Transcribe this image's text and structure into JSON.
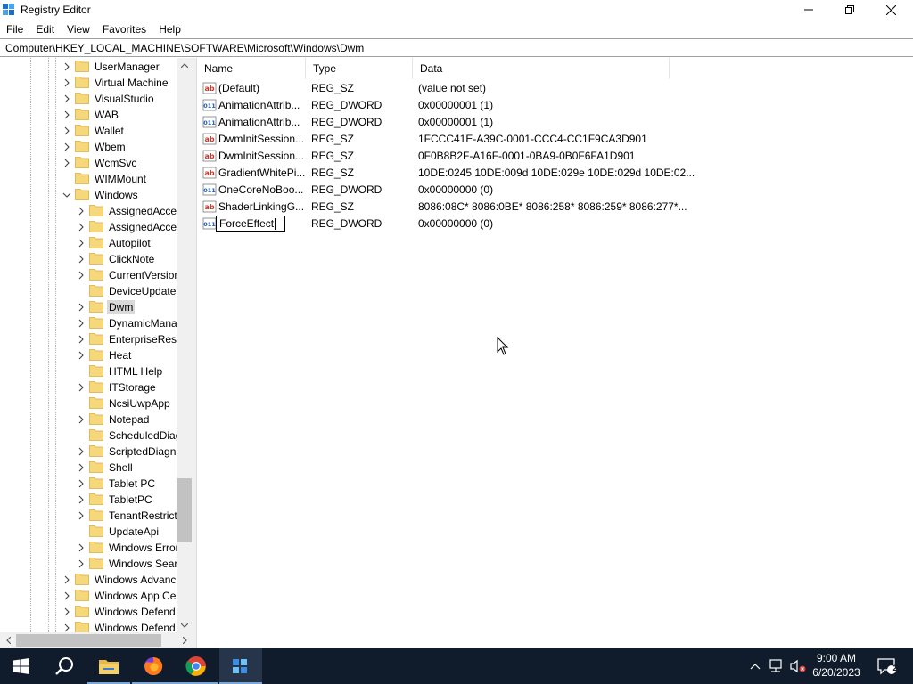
{
  "window": {
    "title": "Registry Editor"
  },
  "menu": [
    "File",
    "Edit",
    "View",
    "Favorites",
    "Help"
  ],
  "address": "Computer\\HKEY_LOCAL_MACHINE\\SOFTWARE\\Microsoft\\Windows\\Dwm",
  "tree": {
    "items": [
      {
        "label": "UserManager",
        "level": 1,
        "expanded": false,
        "expandable": true
      },
      {
        "label": "Virtual Machine",
        "level": 1,
        "expanded": false,
        "expandable": true
      },
      {
        "label": "VisualStudio",
        "level": 1,
        "expanded": false,
        "expandable": true
      },
      {
        "label": "WAB",
        "level": 1,
        "expanded": false,
        "expandable": true
      },
      {
        "label": "Wallet",
        "level": 1,
        "expanded": false,
        "expandable": true
      },
      {
        "label": "Wbem",
        "level": 1,
        "expanded": false,
        "expandable": true
      },
      {
        "label": "WcmSvc",
        "level": 1,
        "expanded": false,
        "expandable": true
      },
      {
        "label": "WIMMount",
        "level": 1,
        "expanded": false,
        "expandable": false
      },
      {
        "label": "Windows",
        "level": 1,
        "expanded": true,
        "expandable": true
      },
      {
        "label": "AssignedAcce",
        "level": 2,
        "expanded": false,
        "expandable": true
      },
      {
        "label": "AssignedAcce",
        "level": 2,
        "expanded": false,
        "expandable": true
      },
      {
        "label": "Autopilot",
        "level": 2,
        "expanded": false,
        "expandable": true
      },
      {
        "label": "ClickNote",
        "level": 2,
        "expanded": false,
        "expandable": true
      },
      {
        "label": "CurrentVersion",
        "level": 2,
        "expanded": false,
        "expandable": true
      },
      {
        "label": "DeviceUpdate",
        "level": 2,
        "expanded": false,
        "expandable": false
      },
      {
        "label": "Dwm",
        "level": 2,
        "expanded": false,
        "expandable": true,
        "selected": true
      },
      {
        "label": "DynamicMana",
        "level": 2,
        "expanded": false,
        "expandable": true
      },
      {
        "label": "EnterpriseResc",
        "level": 2,
        "expanded": false,
        "expandable": true
      },
      {
        "label": "Heat",
        "level": 2,
        "expanded": false,
        "expandable": true
      },
      {
        "label": "HTML Help",
        "level": 2,
        "expanded": false,
        "expandable": false
      },
      {
        "label": "ITStorage",
        "level": 2,
        "expanded": false,
        "expandable": true
      },
      {
        "label": "NcsiUwpApp",
        "level": 2,
        "expanded": false,
        "expandable": false
      },
      {
        "label": "Notepad",
        "level": 2,
        "expanded": false,
        "expandable": true
      },
      {
        "label": "ScheduledDiag",
        "level": 2,
        "expanded": false,
        "expandable": false
      },
      {
        "label": "ScriptedDiagn",
        "level": 2,
        "expanded": false,
        "expandable": true
      },
      {
        "label": "Shell",
        "level": 2,
        "expanded": false,
        "expandable": true
      },
      {
        "label": "Tablet PC",
        "level": 2,
        "expanded": false,
        "expandable": true
      },
      {
        "label": "TabletPC",
        "level": 2,
        "expanded": false,
        "expandable": true
      },
      {
        "label": "TenantRestrict",
        "level": 2,
        "expanded": false,
        "expandable": true
      },
      {
        "label": "UpdateApi",
        "level": 2,
        "expanded": false,
        "expandable": false
      },
      {
        "label": "Windows Error",
        "level": 2,
        "expanded": false,
        "expandable": true
      },
      {
        "label": "Windows Sear",
        "level": 2,
        "expanded": false,
        "expandable": true
      },
      {
        "label": "Windows Advanc",
        "level": 1,
        "expanded": false,
        "expandable": true
      },
      {
        "label": "Windows App Ce",
        "level": 1,
        "expanded": false,
        "expandable": true
      },
      {
        "label": "Windows Defend",
        "level": 1,
        "expanded": false,
        "expandable": true
      },
      {
        "label": "Windows Defend",
        "level": 1,
        "expanded": false,
        "expandable": true
      }
    ]
  },
  "values": {
    "columns": [
      "Name",
      "Type",
      "Data"
    ],
    "rows": [
      {
        "icon": "string-value-icon",
        "name": "(Default)",
        "type": "REG_SZ",
        "data": "(value not set)"
      },
      {
        "icon": "dword-value-icon",
        "name": "AnimationAttrib...",
        "type": "REG_DWORD",
        "data": "0x00000001 (1)"
      },
      {
        "icon": "dword-value-icon",
        "name": "AnimationAttrib...",
        "type": "REG_DWORD",
        "data": "0x00000001 (1)"
      },
      {
        "icon": "string-value-icon",
        "name": "DwmInitSession...",
        "type": "REG_SZ",
        "data": "1FCCC41E-A39C-0001-CCC4-CC1F9CA3D901"
      },
      {
        "icon": "string-value-icon",
        "name": "DwmInitSession...",
        "type": "REG_SZ",
        "data": "0F0B8B2F-A16F-0001-0BA9-0B0F6FA1D901"
      },
      {
        "icon": "string-value-icon",
        "name": "GradientWhitePi...",
        "type": "REG_SZ",
        "data": "10DE:0245 10DE:009d 10DE:029e 10DE:029d 10DE:02..."
      },
      {
        "icon": "dword-value-icon",
        "name": "OneCoreNoBoo...",
        "type": "REG_DWORD",
        "data": "0x00000000 (0)"
      },
      {
        "icon": "string-value-icon",
        "name": "ShaderLinkingG...",
        "type": "REG_SZ",
        "data": "8086:08C* 8086:0BE* 8086:258* 8086:259* 8086:277*..."
      },
      {
        "icon": "dword-value-icon",
        "name": "ForceEffect",
        "type": "REG_DWORD",
        "data": "0x00000000 (0)",
        "editing": true
      }
    ]
  },
  "taskbar": {
    "apps": [
      "start-icon",
      "search-icon",
      "file-explorer-icon",
      "firefox-icon",
      "chrome-icon",
      "registry-editor-icon"
    ],
    "clock": {
      "time": "9:00 AM",
      "date": "6/20/2023"
    },
    "notification_count": "2"
  },
  "colors": {
    "taskbar": "#101c2c",
    "folder": "#f5d77c",
    "selection": "#d9d9d9"
  }
}
